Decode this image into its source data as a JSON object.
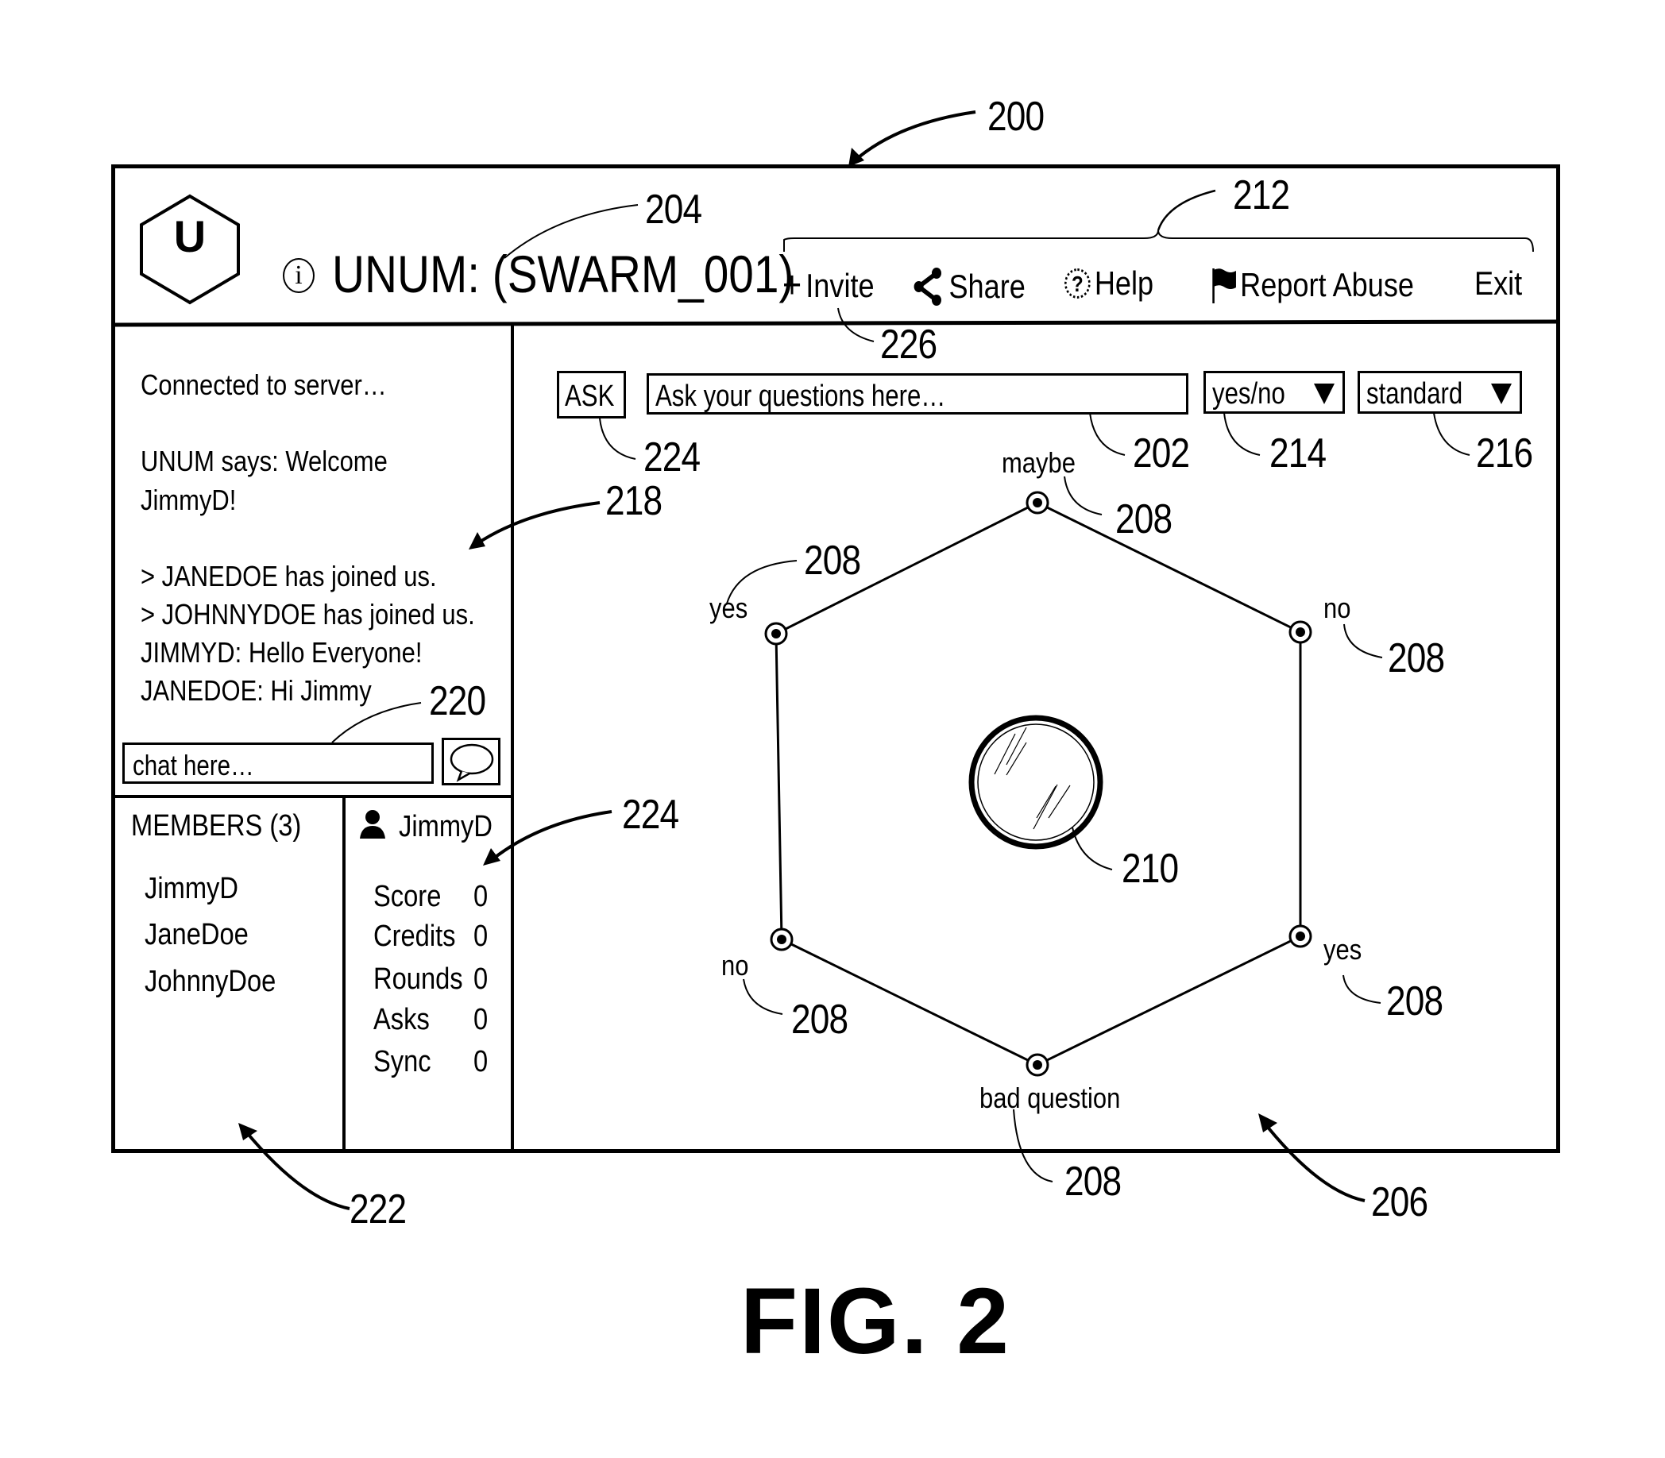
{
  "figure_label": "FIG. 2",
  "reference_numerals": {
    "window": "200",
    "question_input": "202",
    "title": "204",
    "board": "206",
    "answer_options": "208",
    "puck": "210",
    "menu_bar": "212",
    "answer_type_dropdown": "214",
    "mode_dropdown": "216",
    "chat_log": "218",
    "chat_input": "220",
    "members_panel": "222",
    "ask_button": "224",
    "user_stats": "224",
    "invite": "226"
  },
  "header": {
    "logo_letter": "U",
    "info_icon": "i",
    "title": "UNUM: (SWARM_001)",
    "menu": [
      {
        "icon": "plus-icon",
        "label": "Invite"
      },
      {
        "icon": "share-icon",
        "label": "Share"
      },
      {
        "icon": "help-icon",
        "label": "Help"
      },
      {
        "icon": "flag-icon",
        "label": "Report Abuse"
      },
      {
        "icon": "",
        "label": "Exit"
      }
    ]
  },
  "chat": {
    "messages": [
      "Connected to server…",
      "UNUM says: Welcome",
      "JimmyD!",
      "> JANEDOE has joined us.",
      "> JOHNNYDOE has joined us.",
      "JIMMYD: Hello Everyone!",
      "JANEDOE: Hi Jimmy"
    ],
    "input_placeholder": "chat here…",
    "send_icon": "speech-bubble-icon"
  },
  "members": {
    "heading": "MEMBERS (3)",
    "list": [
      "JimmyD",
      "JaneDoe",
      "JohnnyDoe"
    ]
  },
  "user_stats": {
    "username": "JimmyD",
    "stats": [
      {
        "label": "Score",
        "value": "0"
      },
      {
        "label": "Credits",
        "value": "0"
      },
      {
        "label": "Rounds",
        "value": "0"
      },
      {
        "label": "Asks",
        "value": "0"
      },
      {
        "label": "Sync",
        "value": "0"
      }
    ]
  },
  "ask_bar": {
    "ask_label": "ASK",
    "question_placeholder": "Ask your questions here…",
    "answer_type_selected": "yes/no",
    "mode_selected": "standard"
  },
  "board": {
    "options": [
      {
        "position": "top",
        "label": "maybe"
      },
      {
        "position": "upper-right",
        "label": "no"
      },
      {
        "position": "lower-right",
        "label": "yes"
      },
      {
        "position": "bottom",
        "label": "bad question"
      },
      {
        "position": "lower-left",
        "label": "no"
      },
      {
        "position": "upper-left",
        "label": "yes"
      }
    ]
  }
}
